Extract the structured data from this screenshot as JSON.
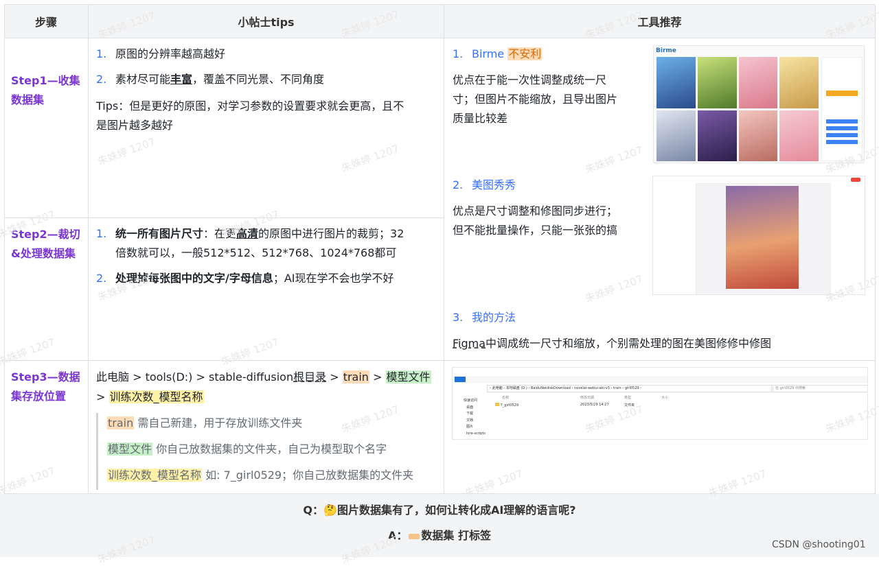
{
  "table": {
    "headers": [
      "步骤",
      "小帖士tips",
      "工具推荐"
    ],
    "rows": [
      {
        "step": "Step1—收集数据集",
        "tips": [
          "原图的分辨率越高越好",
          "素材尽可能丰富，覆盖不同光景、不同角度",
          "Tips：但是更好的原图，对学习参数的设置要求就会更高，且不是图片越多越好"
        ],
        "tip2_pre": "素材尽可能",
        "tip2_bold": "丰富",
        "tip2_post": "，覆盖不同光景、不同角度",
        "tip3_line1": "Tips：但是更好的原图，对学习参数的设置要求就会更高，且不",
        "tip3_line2": "是图片越多越好"
      },
      {
        "step": "Step2—裁切&处理数据集",
        "tip1_bold": "统一所有图片尺寸",
        "tip1_mid": "：在更",
        "tip1_ul": "高清",
        "tip1_post": "的原图中进行图片的裁剪；32",
        "tip1_line2": "倍数就可以，一般512*512、512*768、1024*768都可",
        "tip2_bold": "处理掉每张图中的文字/字母信息",
        "tip2_post": "；AI现在学不会也学不好"
      },
      {
        "step": "Step3—数据集存放位置",
        "path_pre": "此电脑 > tools(D:) > stable-diffusion",
        "path_ul": "根目录",
        "path_sep1": " > ",
        "path_train": "train",
        "path_sep2": " > ",
        "path_model": "模型文件",
        "path_sep3": "> ",
        "path_count": "训练次数_模型名称",
        "quote1_hl": "train",
        "quote1_text": " 需自己新建，用于存放训练文件夹",
        "quote2_hl": "模型文件",
        "quote2_text": " 你自己放数据集的文件夹，自己为模型取个名字",
        "quote3_hl": "训练次数_模型名称",
        "quote3_text": " 如: 7_girl0529；你自己放数据集的文件夹"
      }
    ],
    "tools": {
      "t1_num": "1.",
      "t1_name": "Birme",
      "t1_tag": "不安利",
      "t1_desc1": "优点在于能一次性调整成统一尺",
      "t1_desc2": "寸；但图片不能缩放，且导出图片",
      "t1_desc3": "质量比较差",
      "t2_num": "2.",
      "t2_name": "美图秀秀",
      "t2_desc1": "优点是尺寸调整和修图同步进行；",
      "t2_desc2": "但不能批量操作，只能一张张的搞",
      "t3_num": "3.",
      "t3_name": "我的方法",
      "t3_desc_ul": "Figma",
      "t3_desc": "中调成统一尺寸和缩放，个别需处理的图在美图修修中修图"
    },
    "tip_nums": [
      "1.",
      "2."
    ]
  },
  "footer": {
    "q": "Q：🤔图片数据集有了，如何让转化成AI理解的语言呢?",
    "a_pre": "A：",
    "a_bold": "数据集 打标签"
  },
  "watermark": "朱姝婷 1207",
  "credit": "CSDN @shooting01",
  "explorer": {
    "path": "› 此电脑 › 本地磁盘 (D:) › BaiduNetdiskDownload › novelai-webui-aki-v3 › train › girl0529 ›",
    "search": "在 girl0529 中搜索",
    "folder": "7_girl0529",
    "date": "2023/5/29 14:27",
    "type": "文件夹",
    "sidebar": [
      "快速访问",
      "桌面",
      "下载",
      "文档",
      "图片",
      "lora-scripts"
    ],
    "cols": [
      "名称",
      "修改日期",
      "类型",
      "大小"
    ]
  },
  "birme_title": "Birme",
  "colors": {
    "step": "#7b35d4",
    "accent": "#3370ff"
  }
}
